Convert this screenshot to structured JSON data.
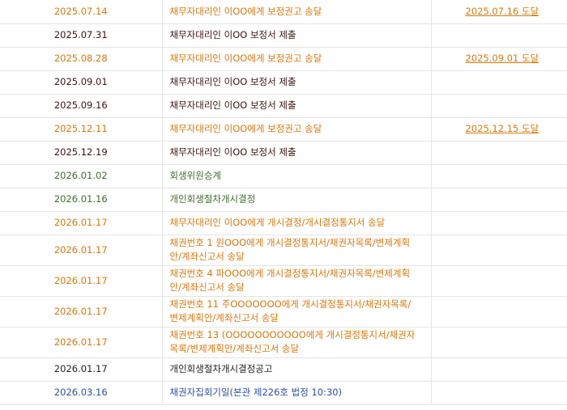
{
  "rows": [
    {
      "date": "2025.07.14",
      "content": "채무자대리인 이OO에게 보정권고 송달",
      "result": "2025.07.16 도달",
      "color": "orange"
    },
    {
      "date": "2025.07.31",
      "content": "채무자대리인 이OO 보정서 제출",
      "result": "",
      "color": "maroon"
    },
    {
      "date": "2025.08.28",
      "content": "채무자대리인 이OO에게 보정권고 송달",
      "result": "2025.09.01 도달",
      "color": "orange"
    },
    {
      "date": "2025.09.01",
      "content": "채무자대리인 이OO 보정서 제출",
      "result": "",
      "color": "maroon"
    },
    {
      "date": "2025.09.16",
      "content": "채무자대리인 이OO 보정서 제출",
      "result": "",
      "color": "maroon"
    },
    {
      "date": "2025.12.11",
      "content": "채무자대리인 이OO에게 보정권고 송달",
      "result": "2025.12.15 도달",
      "color": "orange"
    },
    {
      "date": "2025.12.19",
      "content": "채무자대리인 이OO 보정서 제출",
      "result": "",
      "color": "maroon"
    },
    {
      "date": "2026.01.02",
      "content": "회생위원승계",
      "result": "",
      "color": "green"
    },
    {
      "date": "2026.01.16",
      "content": "개인회생절차개시결정",
      "result": "",
      "color": "green"
    },
    {
      "date": "2026.01.17",
      "content": "채무자대리인 이OO에게 개시결정/개시결정통지서 송달",
      "result": "",
      "color": "orange"
    },
    {
      "date": "2026.01.17",
      "content": "채권번호 1 원OOO에게 개시결정통지서/채권자목록/변제계획안/계좌신고서 송달",
      "result": "",
      "color": "orange"
    },
    {
      "date": "2026.01.17",
      "content": "채권번호 4 파OOO에게 개시결정통지서/채권자목록/변제계획안/계좌신고서 송달",
      "result": "",
      "color": "orange"
    },
    {
      "date": "2026.01.17",
      "content": "채권번호 11 주OOOOOOO에게 개시결정통지서/채권자목록/변제계획안/계좌신고서 송달",
      "result": "",
      "color": "orange"
    },
    {
      "date": "2026.01.17",
      "content": "채권번호 13 (OOOOOOOOOOO에게 개시결정통지서/채권자목록/변제계획안/계좌신고서 송달",
      "result": "",
      "color": "orange"
    },
    {
      "date": "2026.01.17",
      "content": "개인회생절차개시결정공고",
      "result": "",
      "color": "black"
    },
    {
      "date": "2026.03.16",
      "content": "채권자집회기일(본관 제226호 법정 10:30)",
      "result": "",
      "color": "blue"
    }
  ]
}
